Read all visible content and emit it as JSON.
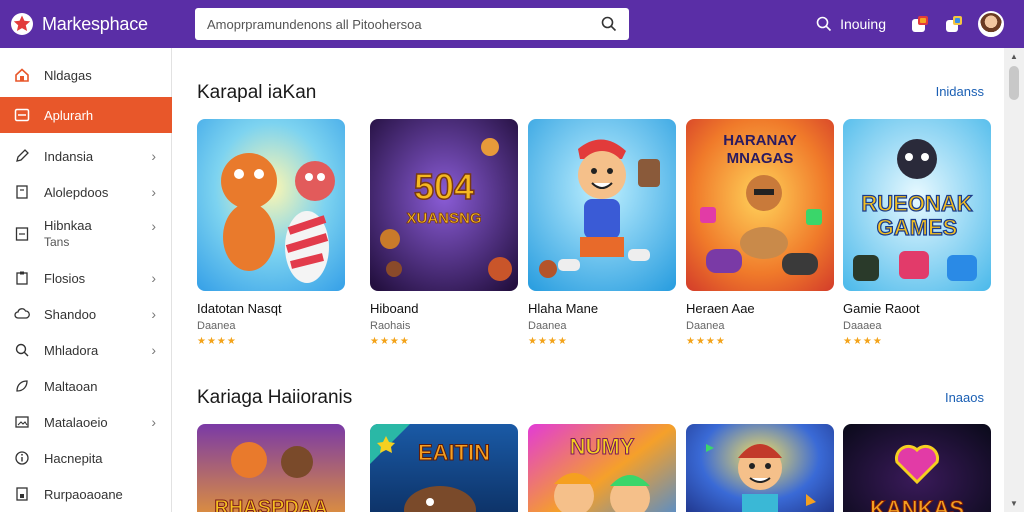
{
  "app": {
    "name": "Markesphace"
  },
  "search": {
    "placeholder": "Amoprpramundenons all Pitoohersoa",
    "icon": "search-icon"
  },
  "topbar": {
    "search_label": "Inouing"
  },
  "sidebar": {
    "items": [
      {
        "label": "Nldagas",
        "icon": "home-icon",
        "chevron": false,
        "active": false
      },
      {
        "label": "Aplurarh",
        "icon": "apps-icon",
        "chevron": false,
        "active": true
      },
      {
        "label": "Indansia",
        "icon": "pencil-icon",
        "chevron": true
      },
      {
        "label": "Alolepdoos",
        "icon": "book-icon",
        "chevron": true
      },
      {
        "label": "Hibnkaa",
        "sublabel": "Tans",
        "icon": "document-icon",
        "chevron": true
      },
      {
        "label": "Flosios",
        "icon": "clipboard-icon",
        "chevron": true
      },
      {
        "label": "Shandoo",
        "icon": "cloud-icon",
        "chevron": true
      },
      {
        "label": "Mhladora",
        "icon": "search-icon",
        "chevron": true
      },
      {
        "label": "Maltaoan",
        "icon": "leaf-icon",
        "chevron": false
      },
      {
        "label": "Matalaoeio",
        "icon": "image-icon",
        "chevron": true
      },
      {
        "label": "Hacnepita",
        "icon": "info-icon",
        "chevron": false
      },
      {
        "label": "Rurpaoaoane",
        "icon": "bookmark-icon",
        "chevron": false
      }
    ],
    "chevron_glyph": "›"
  },
  "sections": [
    {
      "title": "Karapal iaKan",
      "link": "Inidanss",
      "cards": [
        {
          "title": "Idatotan Nasqt",
          "category": "Daanea",
          "stars": "★★★★",
          "art_text": ""
        },
        {
          "title": "Hiboand",
          "category": "Raohais",
          "stars": "★★★★",
          "art_text": "504\nXUANSNG"
        },
        {
          "title": "Hlaha Mane",
          "category": "Daanea",
          "stars": "★★★★",
          "art_text": ""
        },
        {
          "title": "Heraen Aae",
          "category": "Daanea",
          "stars": "★★★★",
          "art_text": "HARANAY\nMNAGAS"
        },
        {
          "title": "Gamie Raoot",
          "category": "Daaaea",
          "stars": "★★★★",
          "art_text": "RUEONAK\nGAMES"
        }
      ]
    },
    {
      "title": "Kariaga Haiioranis",
      "link": "Inaaos",
      "cards": [
        {
          "art_text": "RHASPDAA"
        },
        {
          "art_text": "EAITIN"
        },
        {
          "art_text": "NUMY"
        },
        {
          "art_text": ""
        },
        {
          "art_text": "KANKAS"
        }
      ]
    }
  ],
  "colors": {
    "topbar": "#5a2ea6",
    "active": "#e8572a",
    "link": "#1a5fb4",
    "star": "#f3a31a"
  }
}
